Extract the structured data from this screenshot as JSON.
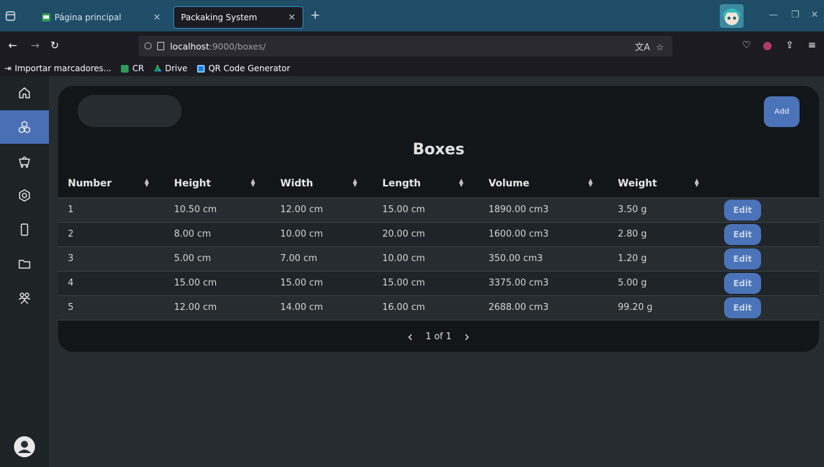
{
  "browser": {
    "tabs": [
      {
        "label": "Página principal",
        "active": false
      },
      {
        "label": "Packaking System",
        "active": true
      }
    ],
    "url_host": "localhost",
    "url_rest": ":9000/boxes/",
    "bookmarks": [
      {
        "label": "Importar marcadores...",
        "icon": "import-icon"
      },
      {
        "label": "CR",
        "icon": "cr-favicon"
      },
      {
        "label": "Drive",
        "icon": "drive-icon"
      },
      {
        "label": "QR Code Generator",
        "icon": "qr-icon"
      }
    ]
  },
  "sidebar": {
    "items": [
      {
        "name": "home",
        "icon": "home-icon",
        "active": false
      },
      {
        "name": "boxes",
        "icon": "boxes-icon",
        "active": true
      },
      {
        "name": "cart",
        "icon": "cart-icon",
        "active": false
      },
      {
        "name": "settings",
        "icon": "hexagon-icon",
        "active": false
      },
      {
        "name": "device",
        "icon": "phone-icon",
        "active": false
      },
      {
        "name": "folder",
        "icon": "folder-icon",
        "active": false
      },
      {
        "name": "users",
        "icon": "users-icon",
        "active": false
      }
    ]
  },
  "main": {
    "add_label": "Add",
    "title": "Boxes",
    "columns": [
      "Number",
      "Height",
      "Width",
      "Length",
      "Volume",
      "Weight"
    ],
    "rows": [
      [
        "1",
        "10.50 cm",
        "12.00 cm",
        "15.00 cm",
        "1890.00 cm3",
        "3.50 g"
      ],
      [
        "2",
        "8.00 cm",
        "10.00 cm",
        "20.00 cm",
        "1600.00 cm3",
        "2.80 g"
      ],
      [
        "3",
        "5.00 cm",
        "7.00 cm",
        "10.00 cm",
        "350.00 cm3",
        "1.20 g"
      ],
      [
        "4",
        "15.00 cm",
        "15.00 cm",
        "15.00 cm",
        "3375.00 cm3",
        "5.00 g"
      ],
      [
        "5",
        "12.00 cm",
        "14.00 cm",
        "16.00 cm",
        "2688.00 cm3",
        "99.20 g"
      ]
    ],
    "edit_label": "Edit",
    "pagination": "1 of 1"
  },
  "colors": {
    "accent": "#4a73b8",
    "panel": "#121619",
    "background": "#262c30"
  }
}
